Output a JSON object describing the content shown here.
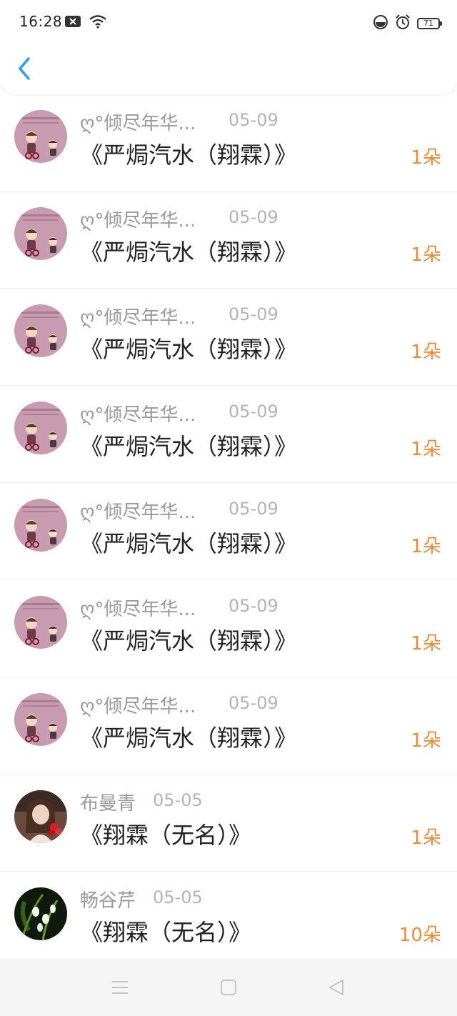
{
  "status_bar": {
    "time": "16:28",
    "battery": "71",
    "icons": [
      "notification-icon",
      "wifi-icon",
      "do-not-disturb-icon",
      "alarm-icon",
      "battery-icon"
    ]
  },
  "header": {
    "back_icon": "chevron-left-icon"
  },
  "colors": {
    "accent": "#2aa3e6",
    "count": "#ee8a3a",
    "name": "#9a9a9a",
    "title": "#222222"
  },
  "items": [
    {
      "name": "ღ°倾尽年华...",
      "date": "05-09",
      "title": "《严焗汽水（翔霖）》",
      "count": "1朵",
      "avatar": "cartoon-kids-avatar"
    },
    {
      "name": "ღ°倾尽年华...",
      "date": "05-09",
      "title": "《严焗汽水（翔霖）》",
      "count": "1朵",
      "avatar": "cartoon-kids-avatar"
    },
    {
      "name": "ღ°倾尽年华...",
      "date": "05-09",
      "title": "《严焗汽水（翔霖）》",
      "count": "1朵",
      "avatar": "cartoon-kids-avatar"
    },
    {
      "name": "ღ°倾尽年华...",
      "date": "05-09",
      "title": "《严焗汽水（翔霖）》",
      "count": "1朵",
      "avatar": "cartoon-kids-avatar"
    },
    {
      "name": "ღ°倾尽年华...",
      "date": "05-09",
      "title": "《严焗汽水（翔霖）》",
      "count": "1朵",
      "avatar": "cartoon-kids-avatar"
    },
    {
      "name": "ღ°倾尽年华...",
      "date": "05-09",
      "title": "《严焗汽水（翔霖）》",
      "count": "1朵",
      "avatar": "cartoon-kids-avatar"
    },
    {
      "name": "ღ°倾尽年华...",
      "date": "05-09",
      "title": "《严焗汽水（翔霖）》",
      "count": "1朵",
      "avatar": "cartoon-kids-avatar"
    },
    {
      "name": "布曼青",
      "date": "05-05",
      "title": "《翔霖（无名）》",
      "count": "1朵",
      "avatar": "girl-photo-avatar"
    },
    {
      "name": "畅谷芹",
      "date": "05-05",
      "title": "《翔霖（无名）》",
      "count": "10朵",
      "avatar": "flower-photo-avatar"
    }
  ],
  "bottom_nav": {
    "icons": [
      "menu-icon",
      "home-square-icon",
      "back-triangle-icon"
    ]
  }
}
